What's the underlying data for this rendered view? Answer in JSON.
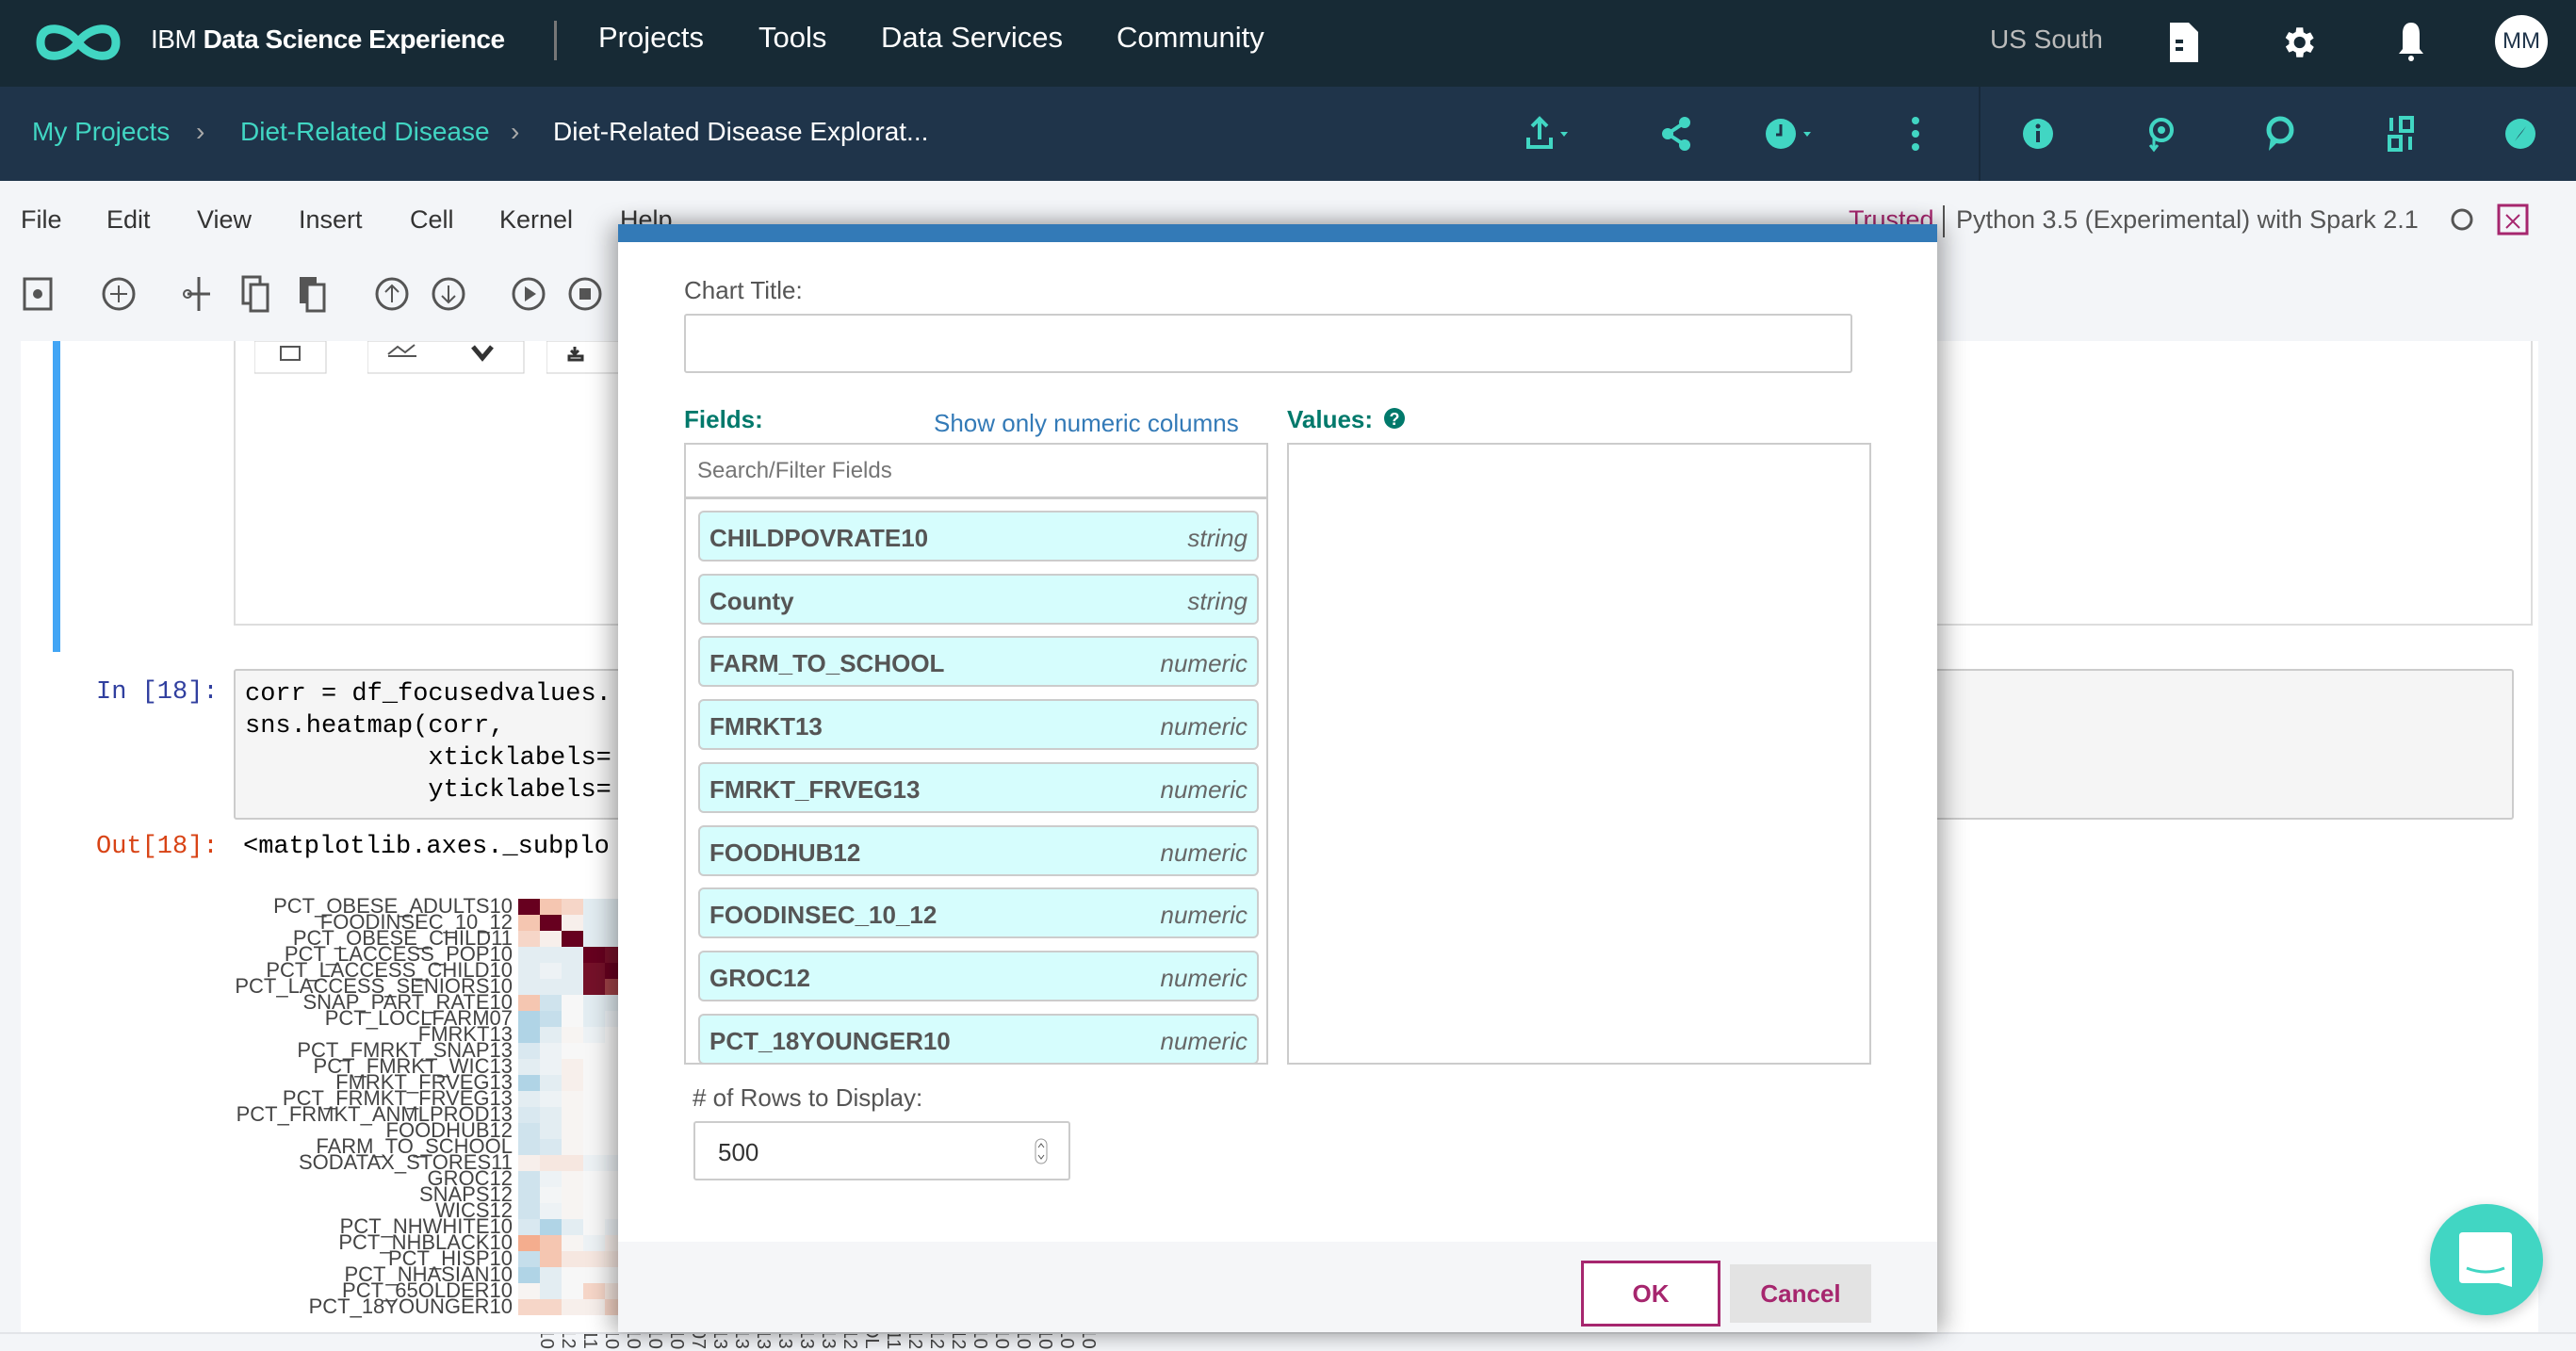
{
  "topnav": {
    "brand_prefix": "IBM",
    "brand_name": "Data Science Experience",
    "items": [
      "Projects",
      "Tools",
      "Data Services",
      "Community"
    ],
    "region": "US South",
    "avatar": "MM"
  },
  "breadcrumb": {
    "items": [
      "My Projects",
      "Diet-Related Disease",
      "Diet-Related Disease Explorat..."
    ],
    "sep": "›"
  },
  "menu": {
    "items": [
      "File",
      "Edit",
      "View",
      "Insert",
      "Cell",
      "Kernel",
      "Help"
    ],
    "trusted": "Trusted",
    "kernel": "Python 3.5 (Experimental) with Spark 2.1"
  },
  "notebook": {
    "in_prompt": "In [18]:",
    "code": [
      "corr = df_focusedvalues.",
      "sns.heatmap(corr,",
      "            xticklabels=",
      "            yticklabels="
    ],
    "out_prompt": "Out[18]:",
    "out_text": "<matplotlib.axes._subplo",
    "heatmap": {
      "labels": [
        "PCT_OBESE_ADULTS10",
        "FOODINSEC_10_12",
        "PCT_OBESE_CHILD11",
        "PCT_LACCESS_POP10",
        "PCT_LACCESS_CHILD10",
        "PCT_LACCESS_SENIORS10",
        "SNAP_PART_RATE10",
        "PCT_LOCLFARM07",
        "FMRKT13",
        "PCT_FMRKT_SNAP13",
        "PCT_FMRKT_WIC13",
        "FMRKT_FRVEG13",
        "PCT_FRMKT_FRVEG13",
        "PCT_FRMKT_ANMLPROD13",
        "FOODHUB12",
        "FARM_TO_SCHOOL",
        "SODATAX_STORES11",
        "GROC12",
        "SNAPS12",
        "WICS12",
        "PCT_NHWHITE10",
        "PCT_NHBLACK10",
        "PCT_HISP10",
        "PCT_NHASIAN10",
        "PCT_65OLDER10",
        "PCT_18YOUNGER10"
      ],
      "values": [
        [
          1,
          0.3,
          0.2,
          -0.1,
          -0.1
        ],
        [
          0.3,
          1,
          0.05,
          -0.1,
          -0.1
        ],
        [
          0.2,
          0.05,
          1,
          -0.1,
          -0.1
        ],
        [
          -0.1,
          -0.1,
          -0.1,
          1,
          0.95
        ],
        [
          -0.1,
          -0.05,
          -0.1,
          0.95,
          1
        ],
        [
          -0.1,
          -0.1,
          -0.1,
          0.95,
          0.8
        ],
        [
          0.3,
          -0.2,
          0,
          -0.1,
          -0.1
        ],
        [
          -0.35,
          -0.25,
          0,
          -0.1,
          -0.05
        ],
        [
          -0.35,
          -0.1,
          0.02,
          -0.05,
          0
        ],
        [
          -0.15,
          -0.05,
          0,
          0,
          0
        ],
        [
          -0.1,
          -0.05,
          0.05,
          0,
          0
        ],
        [
          -0.35,
          -0.1,
          0.05,
          0,
          0
        ],
        [
          -0.1,
          -0.05,
          0.02,
          0,
          0
        ],
        [
          -0.15,
          -0.1,
          0.02,
          0,
          0
        ],
        [
          -0.2,
          -0.1,
          0.02,
          0,
          0
        ],
        [
          -0.2,
          -0.15,
          0.02,
          0,
          0
        ],
        [
          0.05,
          0.1,
          0.1,
          -0.05,
          -0.05
        ],
        [
          -0.2,
          -0.05,
          0.02,
          0,
          0
        ],
        [
          -0.2,
          -0.02,
          0.02,
          0,
          0
        ],
        [
          -0.2,
          -0.05,
          0.02,
          0,
          0
        ],
        [
          -0.15,
          -0.35,
          -0.1,
          0,
          -0.05
        ],
        [
          0.45,
          0.3,
          0.02,
          -0.05,
          0.05
        ],
        [
          -0.25,
          0.3,
          0.1,
          0.1,
          0.1
        ],
        [
          -0.35,
          -0.1,
          0,
          0,
          0
        ],
        [
          0.02,
          -0.1,
          0,
          0.2,
          0.1
        ],
        [
          0.2,
          0.2,
          0.05,
          0.05,
          0.2
        ]
      ]
    }
  },
  "dialog": {
    "chart_title_label": "Chart Title:",
    "chart_title_value": "",
    "fields_label": "Fields:",
    "numeric_toggle": "Show only numeric columns",
    "values_label": "Values:",
    "search_placeholder": "Search/Filter Fields",
    "fields": [
      {
        "name": "CHILDPOVRATE10",
        "type": "string"
      },
      {
        "name": "County",
        "type": "string"
      },
      {
        "name": "FARM_TO_SCHOOL",
        "type": "numeric"
      },
      {
        "name": "FMRKT13",
        "type": "numeric"
      },
      {
        "name": "FMRKT_FRVEG13",
        "type": "numeric"
      },
      {
        "name": "FOODHUB12",
        "type": "numeric"
      },
      {
        "name": "FOODINSEC_10_12",
        "type": "numeric"
      },
      {
        "name": "GROC12",
        "type": "numeric"
      },
      {
        "name": "PCT_18YOUNGER10",
        "type": "numeric"
      }
    ],
    "rows_label": "# of Rows to Display:",
    "rows_value": "500",
    "ok": "OK",
    "cancel": "Cancel"
  },
  "colors": {
    "accent": "#41d6c3",
    "nav": "#172a35",
    "crumb_bar": "#1f344a",
    "dialog_header": "#337ab7",
    "magenta": "#a6266e",
    "field_bg": "#d6fdfd",
    "label_green": "#00796b"
  }
}
